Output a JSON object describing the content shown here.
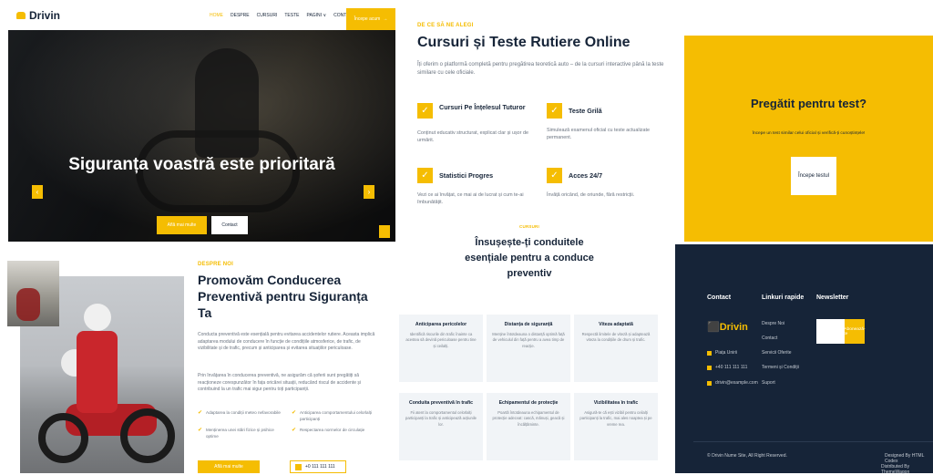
{
  "brand": {
    "name": "Drivin"
  },
  "nav": {
    "items": [
      "HOME",
      "DESPRE",
      "CURSURI",
      "TESTE",
      "PAGINI ∨",
      "CONTACT"
    ],
    "cta": "Începe acum",
    "cta_icon": "→"
  },
  "hero": {
    "title": "Siguranța voastră este prioritară",
    "btn_primary": "Află mai multe",
    "btn_secondary": "Contact",
    "prev_icon": "‹",
    "next_icon": "›"
  },
  "about": {
    "eyebrow": "DESPRE NOI",
    "title": "Promovăm Conducerea Preventivă pentru Siguranța Ta",
    "p1": "Conducta preventivă este esențială pentru evitarea accidentelor rutiere. Aceasta implică adaptarea modului de conducere în funcție de condițiile atmosferice, de trafic, de vizibilitate și de trafic, precum și anticiparea și evitarea situațiilor periculoase.",
    "p2": "Prin învățarea în conducerea preventivă, ne asigurăm că șoferii sunt pregătiți să reacționeze corespunzător în fața oricărei situații, reducând riscul de accidente și contribuind la un trafic mai sigur pentru toți participanții.",
    "checks": [
      "Adaptarea la condiții meteo nefavorabile",
      "Anticiparea comportamentului celorlalți participanți",
      "Menținerea unei stări fizice și psihice optime",
      "Respectarea normelor de circulație"
    ],
    "btn": "Află mai multe",
    "phone": "+0 111 111 111"
  },
  "why": {
    "eyebrow": "DE CE SĂ NE ALEGI",
    "title": "Cursuri și Teste Rutiere Online",
    "subtitle": "Îți oferim o platformă completă pentru pregătirea teoretică auto – de la cursuri interactive până la teste similare cu cele oficiale.",
    "features": [
      {
        "title": "Cursuri Pe Înțelesul Tuturor",
        "desc": "Conținut educativ structurat, explicat clar și ușor de urmărit.",
        "icon": "check-icon"
      },
      {
        "title": "Teste Grilă",
        "desc": "Simulează examenul oficial cu teste actualizate permanent.",
        "icon": "check-icon"
      },
      {
        "title": "Statistici Progres",
        "desc": "Vezi ce ai învățat, ce mai ai de lucrat și cum te-ai îmbunătățit.",
        "icon": "check-icon"
      },
      {
        "title": "Acces 24/7",
        "desc": "Învăță oricând, de oriunde, fără restricții.",
        "icon": "check-icon"
      }
    ]
  },
  "services": {
    "eyebrow": "CURSURI",
    "title": "Însușește-ți conduitele esențiale pentru a conduce preventiv",
    "items": [
      {
        "title": "Anticiparea pericolelor",
        "desc": "Identifică riscurile din trafic înainte ca acestea să devină periculoase pentru tine și ceilalți."
      },
      {
        "title": "Distanța de siguranță",
        "desc": "Menține întotdeauna o distanță optimă față de vehiculul din față pentru a avea timp de reacție."
      },
      {
        "title": "Viteza adaptată",
        "desc": "Respectă limitele de viteză și adaptează viteza la condițiile de drum și trafic."
      },
      {
        "title": "Conduita preventivă în trafic",
        "desc": "Fii atent la comportamentul celorlalți participanți la trafic și anticipează acțiunile lor."
      },
      {
        "title": "Echipamentul de protecție",
        "desc": "Poartă întotdeauna echipamentul de protecție adecvat: cască, mănuși, geacă și încălțăminte."
      },
      {
        "title": "Vizibilitatea în trafic",
        "desc": "Asigură-te că ești vizibil pentru ceilalți participanți la trafic, mai ales noaptea și pe vreme rea."
      }
    ]
  },
  "cta": {
    "title": "Pregătit pentru test?",
    "text": "Începe un test similar celui oficial și verifică-ți cunoștințele!",
    "btn": "Începe testul"
  },
  "footer": {
    "contact_heading": "Contact",
    "links_heading": "Linkuri rapide",
    "newsletter_heading": "Newsletter",
    "brand": "Drivin",
    "contact_rows": [
      "Piața Unirii",
      "+40 111 111 111",
      "drivin@example.com"
    ],
    "links": [
      "Despre Noi",
      "Contact",
      "Servicii Oferite",
      "Termeni și Condiții",
      "Suport"
    ],
    "newsletter_btn": "Abonează-te",
    "copyright": "© Drivin Nume Site, All Right Reserved.",
    "credit_line1": "Designed By HTML Codex",
    "credit_line2": "Distributed By ThemeWagon"
  },
  "colors": {
    "accent": "#f5bd02",
    "navy": "#162438"
  }
}
